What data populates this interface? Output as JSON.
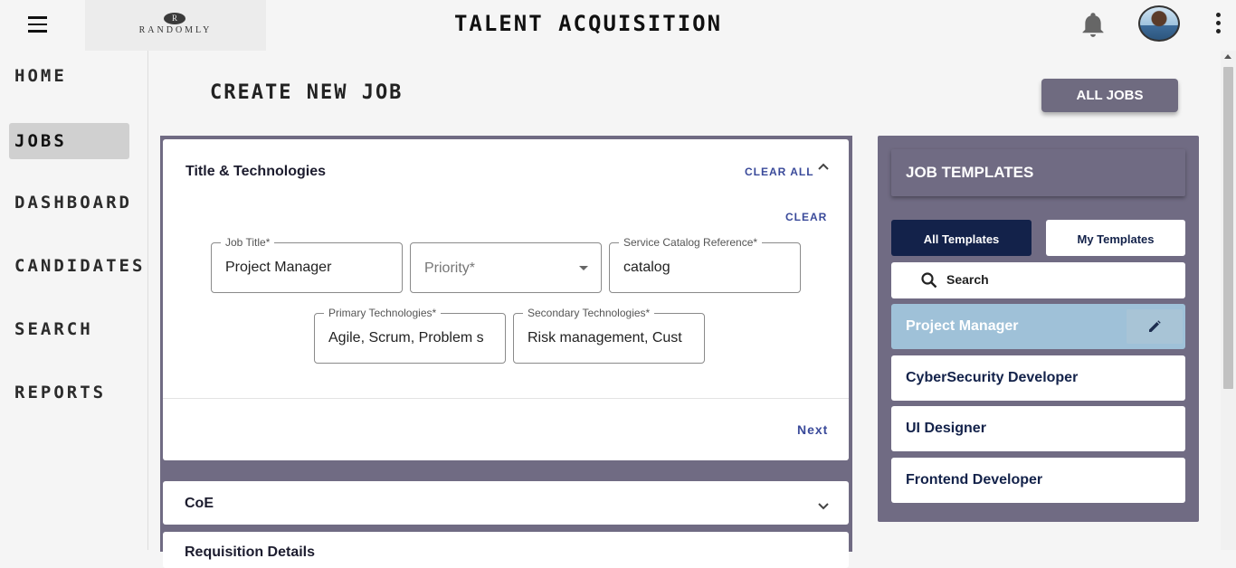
{
  "header": {
    "logo_text": "RANDOMLY",
    "logo_mark": "R",
    "title": "TALENT ACQUISITION"
  },
  "sidebar": {
    "items": [
      {
        "label": "HOME"
      },
      {
        "label": "JOBS"
      },
      {
        "label": "DASHBOARD"
      },
      {
        "label": "CANDIDATES"
      },
      {
        "label": "SEARCH"
      },
      {
        "label": "REPORTS"
      }
    ],
    "active": "JOBS"
  },
  "main": {
    "title": "CREATE NEW JOB",
    "all_jobs_label": "ALL JOBS"
  },
  "form": {
    "section1": {
      "title": "Title & Technologies",
      "clear_all": "CLEAR ALL",
      "clear": "CLEAR",
      "next": "Next"
    },
    "fields": {
      "job_title": {
        "label": "Job Title*",
        "value": "Project Manager"
      },
      "priority": {
        "placeholder": "Priority*"
      },
      "service_catalog": {
        "label": "Service Catalog Reference*",
        "value": "catalog"
      },
      "primary_tech": {
        "label": "Primary Technologies*",
        "value": "Agile, Scrum, Problem s"
      },
      "secondary_tech": {
        "label": "Secondary Technologies*",
        "value": "Risk management, Cust"
      }
    },
    "section2": {
      "title": "CoE"
    },
    "section3": {
      "title": "Requisition Details"
    }
  },
  "templates": {
    "title": "JOB TEMPLATES",
    "tab_all": "All Templates",
    "tab_my": "My Templates",
    "search": "Search",
    "items": [
      {
        "name": "Project Manager"
      },
      {
        "name": "CyberSecurity Developer"
      },
      {
        "name": "UI Designer"
      },
      {
        "name": "Frontend Developer"
      }
    ],
    "selected": "Project Manager"
  },
  "colors": {
    "panel": "#706b83",
    "accent_dark": "#13224a",
    "selected_template": "#9fc1d8",
    "link": "#3a4a9a"
  }
}
